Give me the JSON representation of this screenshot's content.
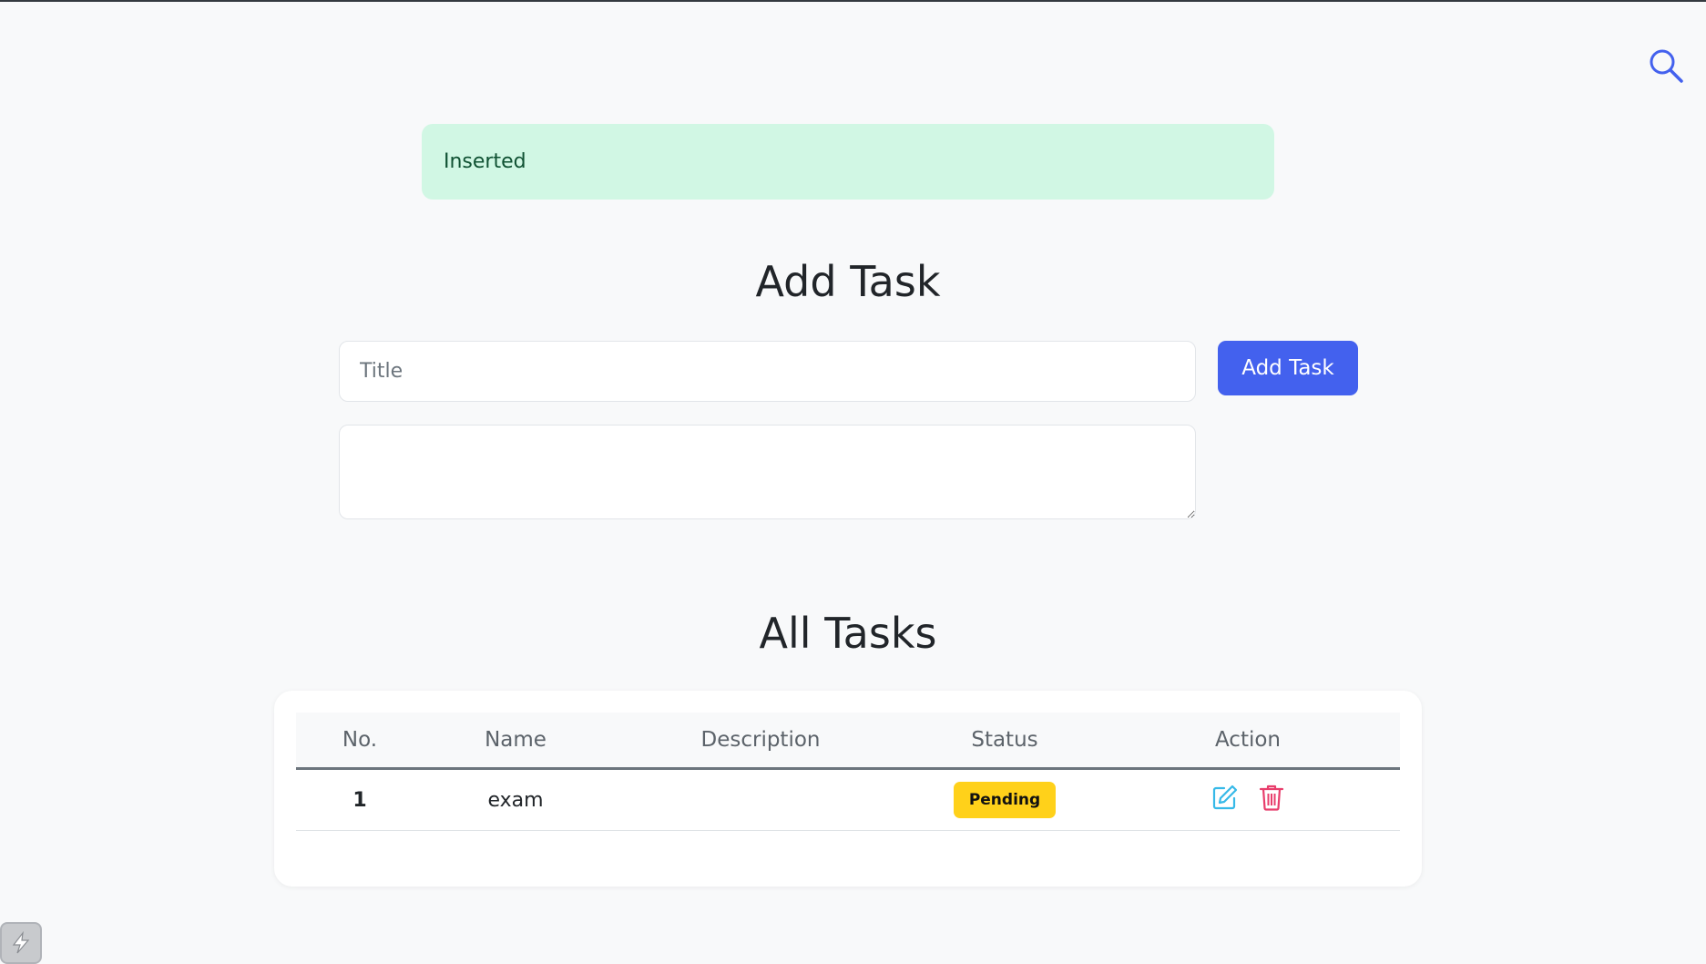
{
  "header": {
    "search_icon": "search-icon"
  },
  "alert": {
    "message": "Inserted",
    "color": "#d1f7e4"
  },
  "add_task": {
    "heading": "Add Task",
    "title_placeholder": "Title",
    "title_value": "",
    "description_value": "",
    "submit_label": "Add Task",
    "accent": "#4361ee"
  },
  "all_tasks": {
    "heading": "All Tasks",
    "columns": [
      "No.",
      "Name",
      "Description",
      "Status",
      "Action"
    ],
    "rows": [
      {
        "no": "1",
        "name": "exam",
        "description": "",
        "status": "Pending",
        "status_color": "#ffd11a",
        "actions": [
          "edit-icon",
          "trash-icon"
        ]
      }
    ]
  }
}
